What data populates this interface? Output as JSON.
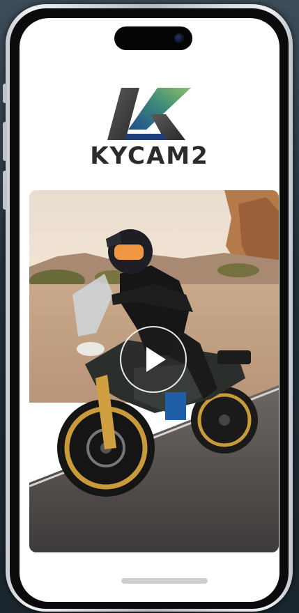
{
  "app": {
    "name": "KYCAM2",
    "logo_icon": "kycam-k-logo-icon"
  },
  "video": {
    "thumbnail": "adventure-motorcycle-rider-desert-road",
    "play_icon": "play-icon"
  },
  "colors": {
    "logo_dark": "#3a3a3a",
    "logo_green": "#7db36a",
    "logo_blue": "#1f4f8c",
    "rim_gold": "#c99a3a",
    "screen_bg": "#ffffff"
  }
}
